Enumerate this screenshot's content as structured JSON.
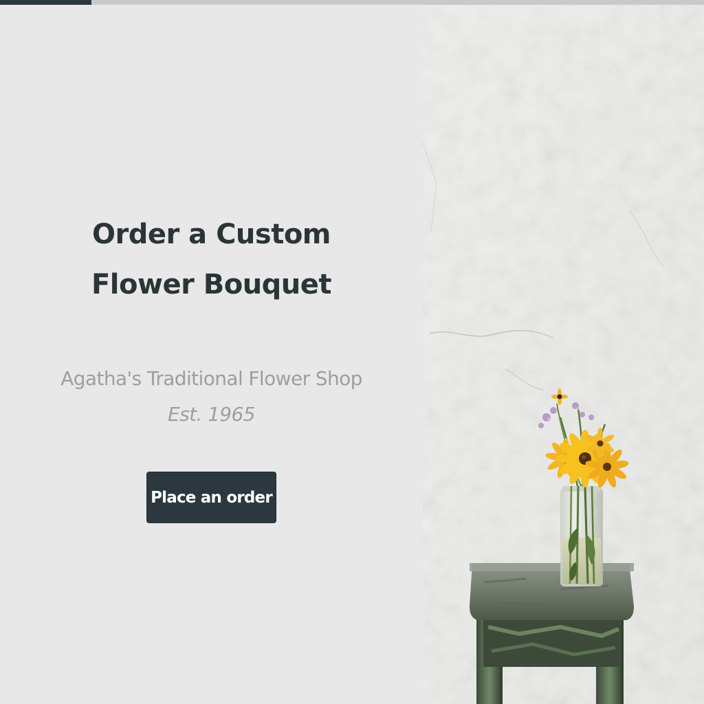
{
  "progress": {
    "value": 0.13
  },
  "hero": {
    "title": "Order a Custom Flower Bouquet",
    "shop_name": "Agatha's Traditional Flower Shop",
    "established": "Est. 1965",
    "cta_label": "Place an order"
  },
  "colors": {
    "accent": "#2b3840",
    "background": "#e8e8e8",
    "title": "#2b3538",
    "muted_text": "#9e9e9e",
    "button_text": "#ffffff"
  },
  "image": {
    "subject": "yellow-flowers-in-glass-jar-on-wooden-stool"
  }
}
